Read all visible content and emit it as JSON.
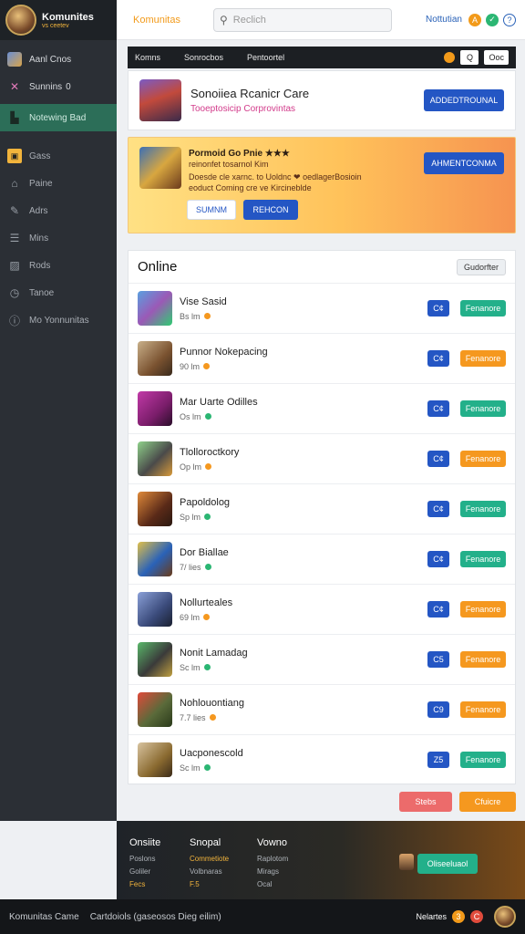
{
  "app": {
    "logo_title": "Komunites",
    "logo_subtitle": "vs ceetev"
  },
  "sidebar": {
    "items": [
      {
        "label": "Aanl Cnos",
        "icon": "game-thumb-icon"
      },
      {
        "label": "Sunnins",
        "icon": "crossed-swords-icon",
        "badge": "0"
      },
      {
        "label": "Notewing Bad",
        "icon": "chart-icon",
        "active": true
      }
    ],
    "secondary": [
      {
        "label": "Gass",
        "icon": "gamepad-icon"
      },
      {
        "label": "Paine",
        "icon": "home-icon"
      },
      {
        "label": "Adrs",
        "icon": "pencil-icon"
      },
      {
        "label": "Mins",
        "icon": "list-icon"
      },
      {
        "label": "Rods",
        "icon": "box-icon"
      },
      {
        "label": "Tanoe",
        "icon": "clock-icon"
      },
      {
        "label": "Mo Yonnunitas",
        "icon": "info-icon"
      }
    ]
  },
  "topbar": {
    "brand": "Komunitas",
    "search_placeholder": "Reclich",
    "notif_label": "Nottutian",
    "badge_a": "A",
    "badge_b": "✓",
    "help": "?"
  },
  "tabs": {
    "items": [
      "Komns",
      "Sonrocbos",
      "Pentoortel"
    ],
    "tool_search": "Q",
    "tool_label": "Ooc"
  },
  "profile": {
    "title": "Sonoiiea Rcanicr Care",
    "subtitle": "Tooeptosicip Corprovintas",
    "button": "ADDEDTROUNAL"
  },
  "promo": {
    "title": "Pormoid Go Pnie ★★★",
    "line1": "reinonfet tosarnol Kim",
    "line2": "Doesde cle xarnc. to Uoldnc ❤ oedlagerBosioin",
    "line3": "eoduct Coming cre ve Kircineblde",
    "button_primary": "AHMENTCONMA",
    "button_a": "SUMNM",
    "button_b": "REHCON"
  },
  "online": {
    "title": "Online",
    "filter": "Gudorfter",
    "rows": [
      {
        "name": "Vise Sasid",
        "meta": "Bs lm",
        "status": "orange",
        "code": "C¢",
        "action": "Fenanore",
        "action_color": "teal"
      },
      {
        "name": "Punnor Nokepacing",
        "meta": "90 lm",
        "status": "orange",
        "code": "C¢",
        "action": "Fenanore",
        "action_color": "orange"
      },
      {
        "name": "Mar Uarte Odilles",
        "meta": "Os lm",
        "status": "green",
        "code": "C¢",
        "action": "Fenanore",
        "action_color": "teal"
      },
      {
        "name": "Tlolloroctkory",
        "meta": "Op lm",
        "status": "orange",
        "code": "C¢",
        "action": "Fenanore",
        "action_color": "orange"
      },
      {
        "name": "Papoldolog",
        "meta": "Sp lm",
        "status": "green",
        "code": "C¢",
        "action": "Fenanore",
        "action_color": "teal"
      },
      {
        "name": "Dor Biallae",
        "meta": "7/ lies",
        "status": "green",
        "code": "C¢",
        "action": "Fenanore",
        "action_color": "teal"
      },
      {
        "name": "Nollurteales",
        "meta": "69 lm",
        "status": "orange",
        "code": "C¢",
        "action": "Fenanore",
        "action_color": "orange"
      },
      {
        "name": "Nonit Lamadag",
        "meta": "Sc lm",
        "status": "green",
        "code": "C5",
        "action": "Fenanore",
        "action_color": "orange"
      },
      {
        "name": "Nohlouontiang",
        "meta": "7.7 lies",
        "status": "orange",
        "code": "C9",
        "action": "Fenanore",
        "action_color": "orange"
      },
      {
        "name": "Uacponescold",
        "meta": "Sc lm",
        "status": "green",
        "code": "Z5",
        "action": "Fenanore",
        "action_color": "teal"
      }
    ],
    "button_left": "Stebs",
    "button_right": "Cfuicre"
  },
  "footer": {
    "columns": [
      {
        "title": "Onsiite",
        "links": [
          "Poslons",
          "Goliler",
          "Fecs"
        ]
      },
      {
        "title": "Snopal",
        "links": [
          "Commetiote",
          "Volbnaras",
          "F.5"
        ]
      },
      {
        "title": "Vowno",
        "links": [
          "Raplotom",
          "Mirags",
          "Ocal"
        ]
      }
    ],
    "cta": "Oliseeluaol"
  },
  "bottombar": {
    "copyright": "Komunitas Came",
    "links": "Cartdoiols (gaseosos   Dieg eilim)",
    "right_label": "Nelartes",
    "badge_a": "3",
    "badge_b": "C"
  },
  "colors": {
    "accent_blue": "#2456c4",
    "teal": "#23b08a",
    "orange": "#f5981f",
    "sidebar_bg": "#2b2f35",
    "active_green": "#2c6e58"
  }
}
